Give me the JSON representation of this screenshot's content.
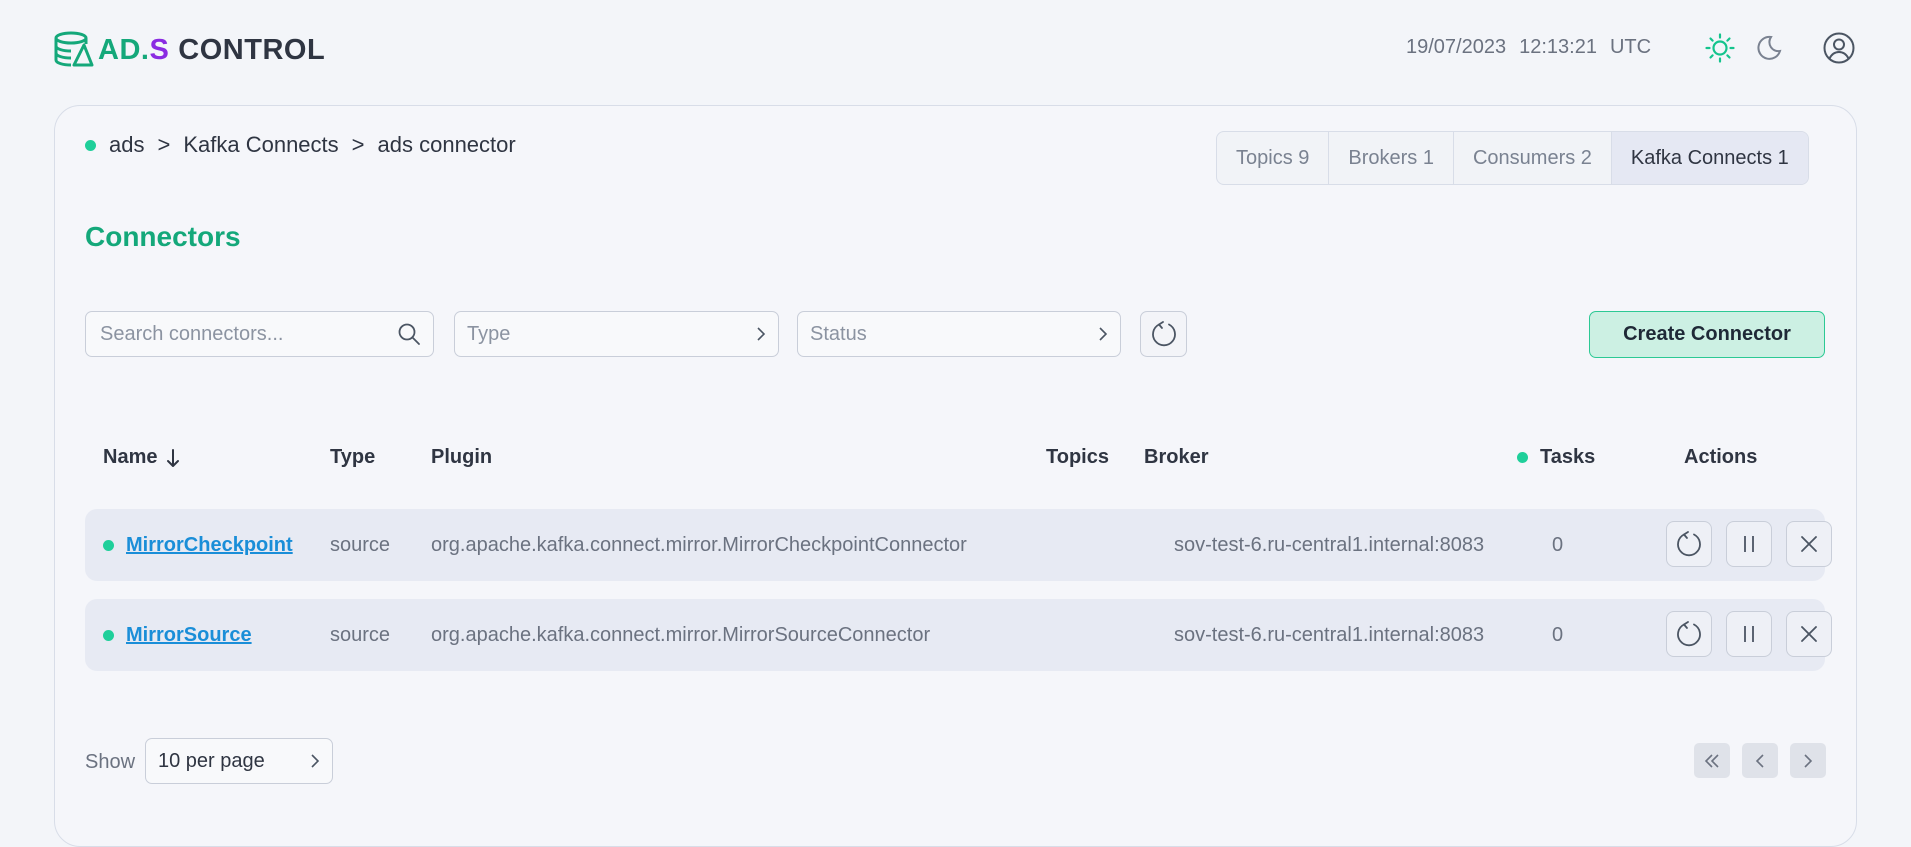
{
  "header": {
    "logo": {
      "ad": "AD.",
      "s": "S",
      "control": "CONTROL"
    },
    "date": "19/07/2023",
    "time": "12:13:21",
    "timezone": "UTC",
    "icons": [
      "sun-icon",
      "moon-icon",
      "user-icon"
    ],
    "accent_color": "#14a87a"
  },
  "breadcrumb": {
    "items": [
      "ads",
      "Kafka Connects",
      "ads connector"
    ],
    "separator": ">"
  },
  "tabs": [
    {
      "label": "Topics 9",
      "active": false
    },
    {
      "label": "Brokers 1",
      "active": false
    },
    {
      "label": "Consumers 2",
      "active": false
    },
    {
      "label": "Kafka Connects 1",
      "active": true
    }
  ],
  "section_title": "Connectors",
  "filters": {
    "search_placeholder": "Search connectors...",
    "type_placeholder": "Type",
    "status_placeholder": "Status"
  },
  "create_button": "Create Connector",
  "table": {
    "headers": {
      "name": "Name",
      "type": "Type",
      "plugin": "Plugin",
      "topics": "Topics",
      "broker": "Broker",
      "tasks": "Tasks",
      "actions": "Actions"
    },
    "sort": {
      "column": "name",
      "direction": "desc"
    },
    "rows": [
      {
        "name": "MirrorCheckpoint",
        "type": "source",
        "plugin": "org.apache.kafka.connect.mirror.MirrorCheckpointConnector",
        "topics": "",
        "broker": "sov-test-6.ru-central1.internal:8083",
        "tasks": "0",
        "status_color": "#1fcf9a"
      },
      {
        "name": "MirrorSource",
        "type": "source",
        "plugin": "org.apache.kafka.connect.mirror.MirrorSourceConnector",
        "topics": "",
        "broker": "sov-test-6.ru-central1.internal:8083",
        "tasks": "0",
        "status_color": "#1fcf9a"
      }
    ]
  },
  "footer": {
    "show_label": "Show",
    "per_page": "10 per page"
  }
}
